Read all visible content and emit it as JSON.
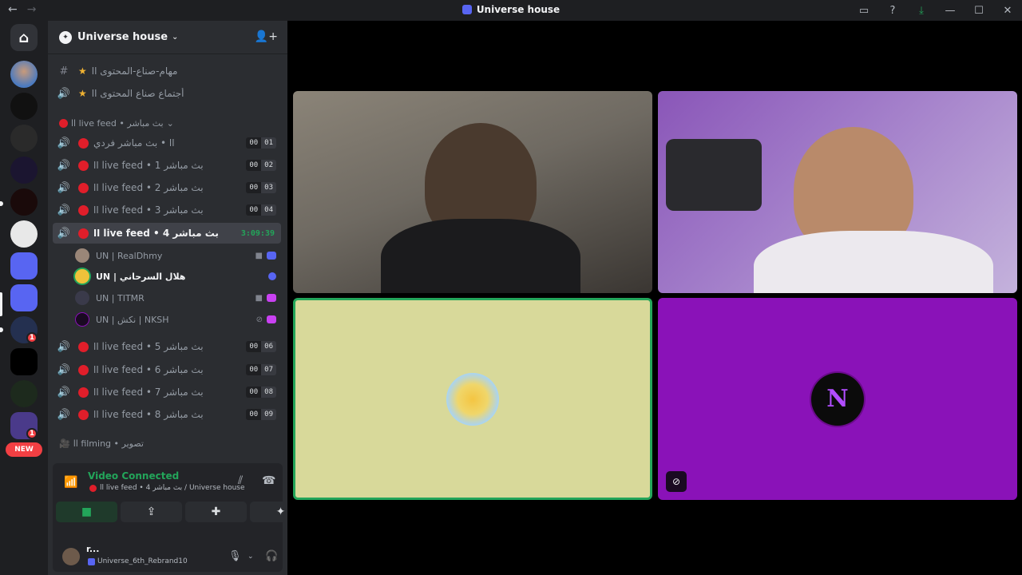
{
  "titlebar": {
    "back": "←",
    "forward": "→",
    "title": "Universe house",
    "icons": [
      "inbox-icon",
      "help-icon",
      "download-icon",
      "minimize-icon",
      "maximize-icon",
      "close-icon"
    ],
    "glyphs": [
      "▭",
      "?",
      "⤓",
      "—",
      "☐",
      "✕"
    ]
  },
  "rail": {
    "home_glyph": "⌂",
    "new_label": "NEW",
    "badges": [
      "1",
      "1"
    ]
  },
  "server": {
    "name": "Universe house",
    "chevron": "⌄",
    "invite_glyph": "👤+"
  },
  "channels": {
    "text_channels": [
      {
        "label": "مهام-صناع-المحتوى اا",
        "icon": "#"
      },
      {
        "label": "أجتماع صناع المحتوى اا",
        "icon": "🔊"
      }
    ],
    "live_category": "اا live feed • بث مباشر",
    "live_category_chevron": "⌄",
    "voice_channels": [
      {
        "label": "اا • بث مباشر فردي",
        "left": "00",
        "right": "01"
      },
      {
        "label": "اا live feed • بث مباشر 1",
        "left": "00",
        "right": "02"
      },
      {
        "label": "اا live feed • بث مباشر 2",
        "left": "00",
        "right": "03"
      },
      {
        "label": "اا live feed • بث مباشر 3",
        "left": "00",
        "right": "04"
      }
    ],
    "active_channel": {
      "label": "اا live feed • بث مباشر 4",
      "timer": "3:09:39"
    },
    "users": [
      {
        "name": "UN | RealDhmy",
        "status_glyph": "■",
        "game_color": "#5865f2"
      },
      {
        "name": "UN | هلال السرحاني",
        "status_glyph": "",
        "game_color": "#5865f2"
      },
      {
        "name": "UN | TITMR",
        "status_glyph": "■",
        "game_color": "#c941f2"
      },
      {
        "name": "UN | نكش | NKSH",
        "status_glyph": "⊘",
        "game_color": "#c941f2"
      }
    ],
    "voice_channels_2": [
      {
        "label": "اا live feed • بث مباشر 5",
        "left": "00",
        "right": "06"
      },
      {
        "label": "اا live feed • بث مباشر 6",
        "left": "00",
        "right": "07"
      },
      {
        "label": "اا live feed • بث مباشر 7",
        "left": "00",
        "right": "08"
      },
      {
        "label": "اا live feed • بث مباشر 8",
        "left": "00",
        "right": "09"
      }
    ],
    "filming_category": "اا filming • تصوير"
  },
  "voice_panel": {
    "status": "Video Connected",
    "location": "اا live feed • بث مباشر 4 / Universe house",
    "buttons": [
      "camera-button",
      "screen-share-button",
      "activities-button",
      "soundboard-button"
    ],
    "glyphs": [
      "■",
      "⇪",
      "✚",
      "✦"
    ]
  },
  "user_panel": {
    "username": "r...",
    "status": "Universe_6th_Rebrand10",
    "mic_glyph": "🎙",
    "headset_glyph": "🎧",
    "settings_glyph": "⚙",
    "chevron": "⌄"
  },
  "stage": {
    "tiles": [
      "camera-feed-1",
      "camera-feed-2",
      "avatar-tile-sun",
      "avatar-tile-nksh"
    ],
    "nksh_letter": "N",
    "mute_glyph": "⊘"
  },
  "colors": {
    "accent_green": "#23a55a",
    "live_red": "#e01e2a",
    "blurple": "#5865f2",
    "tile3_bg": "#d8d99a",
    "tile4_bg": "#8a12b8"
  }
}
